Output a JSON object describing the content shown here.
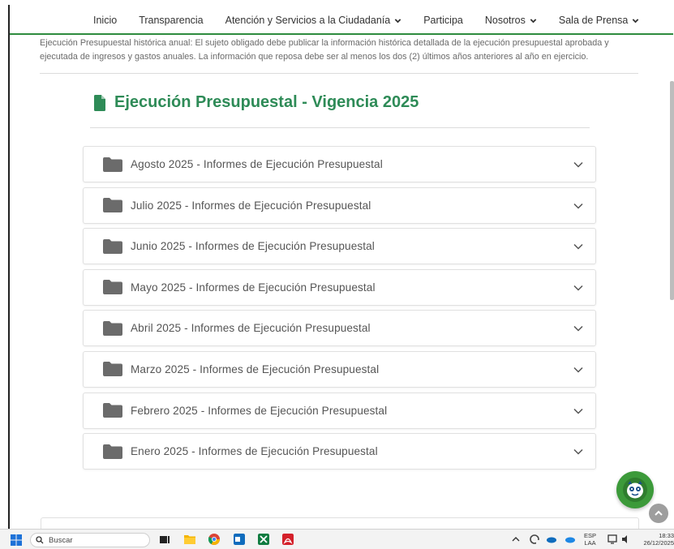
{
  "nav": {
    "items": [
      {
        "label": "Inicio",
        "dropdown": false
      },
      {
        "label": "Transparencia",
        "dropdown": false
      },
      {
        "label": "Atención y Servicios a la Ciudadanía",
        "dropdown": true
      },
      {
        "label": "Participa",
        "dropdown": false
      },
      {
        "label": "Nosotros",
        "dropdown": true
      },
      {
        "label": "Sala de Prensa",
        "dropdown": true
      }
    ]
  },
  "intro": {
    "text": "Ejecución Presupuestal histórica anual: El sujeto obligado debe publicar la información histórica detallada de la ejecución presupuestal aprobada y ejecutada de ingresos y gastos anuales. La información que reposa debe ser al menos los dos (2) últimos años anteriores al año en ejercicio."
  },
  "section": {
    "title": "Ejecución Presupuestal - Vigencia 2025",
    "accent_color": "#2e8b57"
  },
  "accordion": {
    "items": [
      {
        "label": "Agosto 2025 - Informes de Ejecución Presupuestal"
      },
      {
        "label": "Julio 2025 - Informes de Ejecución Presupuestal"
      },
      {
        "label": "Junio 2025 - Informes de Ejecución Presupuestal"
      },
      {
        "label": "Mayo 2025 - Informes de Ejecución Presupuestal"
      },
      {
        "label": "Abril 2025 - Informes de Ejecución Presupuestal"
      },
      {
        "label": "Marzo 2025 - Informes de Ejecución Presupuestal"
      },
      {
        "label": "Febrero 2025 - Informes de Ejecución Presupuestal"
      },
      {
        "label": "Enero 2025 - Informes de Ejecución Presupuestal"
      }
    ]
  },
  "taskbar": {
    "search_placeholder": "Buscar",
    "lang_top": "ESP",
    "lang_bottom": "LAA",
    "time": "18:33",
    "date": "26/12/2025"
  }
}
